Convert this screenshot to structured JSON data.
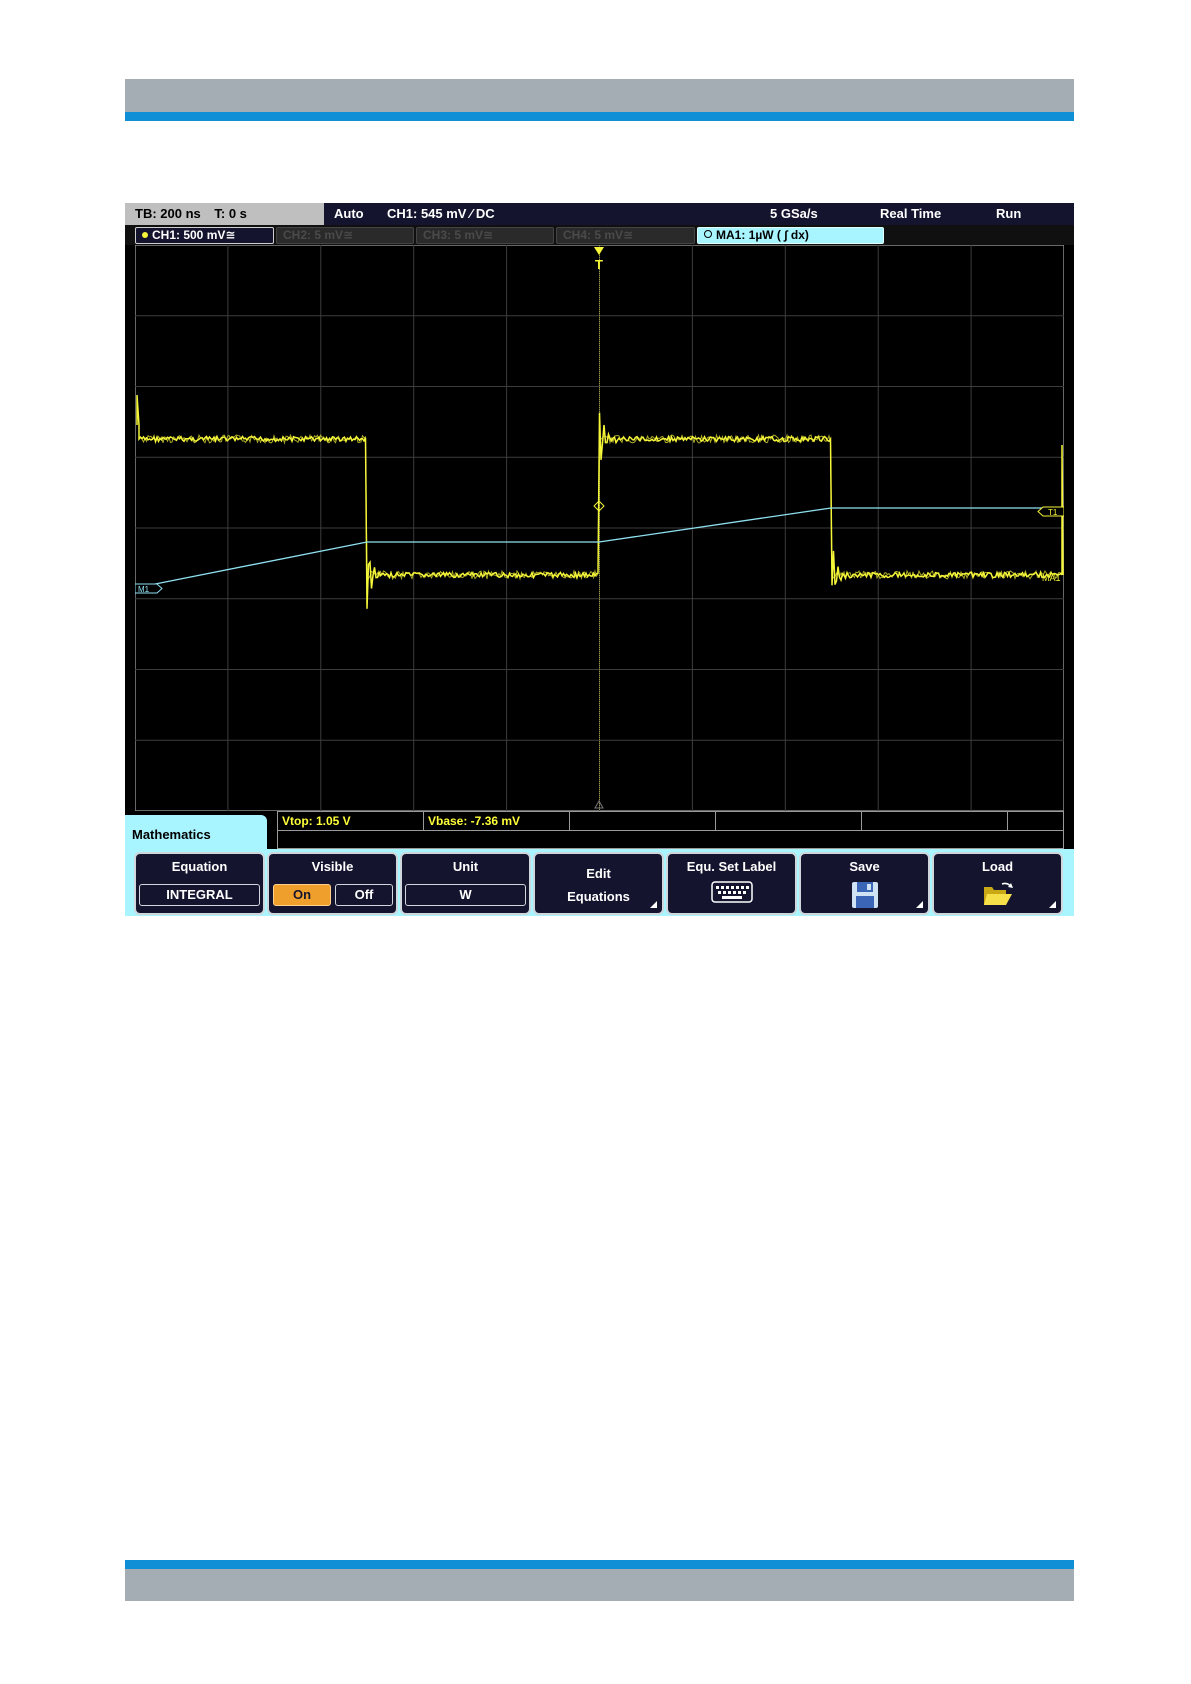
{
  "status": {
    "timebase": "TB: 200 ns",
    "trigger_time": "T: 0 s",
    "trigger_mode": "Auto",
    "trigger_source": "CH1: 545 mV ∕ DC",
    "sample_rate": "5 GSa/s",
    "acq_mode": "Real Time",
    "run_state": "Run"
  },
  "channels": [
    {
      "label": "CH1: 500 mV≅",
      "state": "on"
    },
    {
      "label": "CH2: 5 mV≅",
      "state": "off"
    },
    {
      "label": "CH3: 5 mV≅",
      "state": "off"
    },
    {
      "label": "CH4: 5 mV≅",
      "state": "off"
    },
    {
      "label": "MA1: 1µW ( ∫ dx)",
      "state": "math"
    }
  ],
  "plot": {
    "trigger_marker": "T",
    "math_marker_left": "M1",
    "math_marker_right": "MA1",
    "level_marker": "T1",
    "colors": {
      "ch1": "#f5f53a",
      "math": "#8fe1f0",
      "grid": "#3d3d3d"
    }
  },
  "measurements": {
    "vtop": "Vtop: 1.05 V",
    "vbase": "Vbase: -7.36 mV"
  },
  "menu": {
    "title": "Mathematics",
    "equation": {
      "label": "Equation",
      "value": "INTEGRAL"
    },
    "visible": {
      "label": "Visible",
      "on": "On",
      "off": "Off",
      "selected": "On"
    },
    "unit": {
      "label": "Unit",
      "value": "W"
    },
    "edit": {
      "line1": "Edit",
      "line2": "Equations"
    },
    "set_label": {
      "label": "Equ. Set Label",
      "icon": "keyboard-icon"
    },
    "save": {
      "label": "Save",
      "icon": "floppy-disk-icon"
    },
    "load": {
      "label": "Load",
      "icon": "open-folder-icon"
    }
  }
}
